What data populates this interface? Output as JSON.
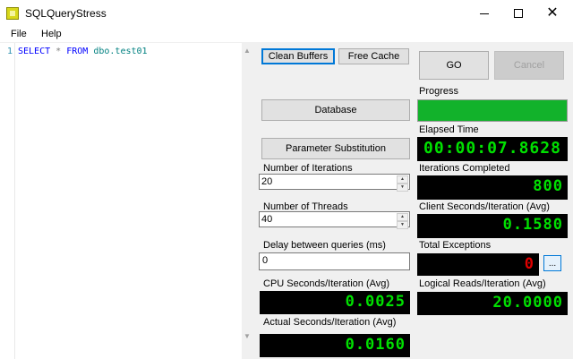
{
  "window": {
    "title": "SQLQueryStress"
  },
  "menu": {
    "file": "File",
    "help": "Help"
  },
  "editor": {
    "line_number": "1",
    "kw_select": "SELECT",
    "star": "*",
    "kw_from": "FROM",
    "table": "dbo.test01"
  },
  "buttons": {
    "clean_buffers": "Clean Buffers",
    "free_cache": "Free Cache",
    "go": "GO",
    "cancel": "Cancel",
    "database": "Database",
    "parameter_substitution": "Parameter Substitution",
    "ellipsis": "..."
  },
  "settings": {
    "iterations_label": "Number of Iterations",
    "iterations_value": "20",
    "threads_label": "Number of Threads",
    "threads_value": "40",
    "delay_label": "Delay between queries (ms)",
    "delay_value": "0"
  },
  "metrics": {
    "progress_label": "Progress",
    "progress_fraction": 1.0,
    "elapsed_label": "Elapsed Time",
    "elapsed_value": "00:00:07.8628",
    "iterations_completed_label": "Iterations Completed",
    "iterations_completed_value": "800",
    "client_seconds_label": "Client Seconds/Iteration (Avg)",
    "client_seconds_value": "0.1580",
    "total_exceptions_label": "Total Exceptions",
    "total_exceptions_value": "0",
    "cpu_seconds_label": "CPU Seconds/Iteration (Avg)",
    "cpu_seconds_value": "0.0025",
    "logical_reads_label": "Logical Reads/Iteration (Avg)",
    "logical_reads_value": "20.0000",
    "actual_seconds_label": "Actual Seconds/Iteration (Avg)",
    "actual_seconds_value": "0.0160"
  },
  "colors": {
    "lcd_green": "#00e000",
    "lcd_red": "#e00000",
    "progress_green": "#12b22b"
  }
}
